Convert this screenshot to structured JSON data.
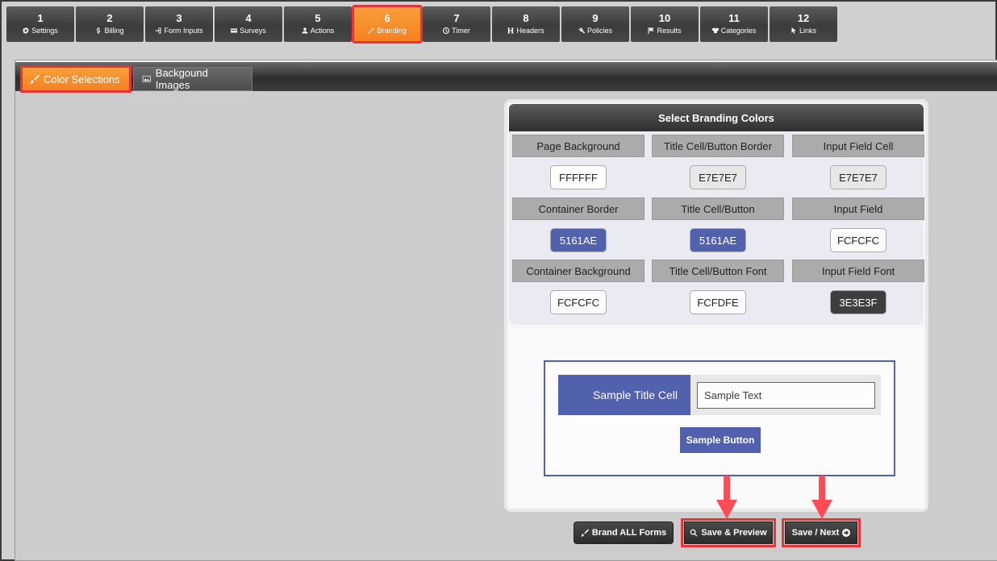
{
  "steps": [
    {
      "num": "1",
      "label": "Settings",
      "icon": "gear-icon"
    },
    {
      "num": "2",
      "label": "Billing",
      "icon": "dollar-icon"
    },
    {
      "num": "3",
      "label": "Form Inputs",
      "icon": "sign-in-icon"
    },
    {
      "num": "4",
      "label": "Surveys",
      "icon": "card-icon"
    },
    {
      "num": "5",
      "label": "Actions",
      "icon": "user-icon"
    },
    {
      "num": "6",
      "label": "Branding",
      "icon": "brush-icon"
    },
    {
      "num": "7",
      "label": "Timer",
      "icon": "clock-icon"
    },
    {
      "num": "8",
      "label": "Headers",
      "icon": "header-icon"
    },
    {
      "num": "9",
      "label": "Policies",
      "icon": "gavel-icon"
    },
    {
      "num": "10",
      "label": "Results",
      "icon": "flag-icon"
    },
    {
      "num": "11",
      "label": "Categories",
      "icon": "cubes-icon"
    },
    {
      "num": "12",
      "label": "Links",
      "icon": "pointer-icon"
    }
  ],
  "active_step": "6",
  "subtabs": {
    "colors": "Color Selections",
    "backgrounds": "Backgound Images"
  },
  "panel": {
    "title": "Select Branding Colors",
    "cells": [
      {
        "label": "Page Background",
        "value": "FFFFFF",
        "bg": "#FFFFFF",
        "fg": "#222222"
      },
      {
        "label": "Title Cell/Button Border",
        "value": "E7E7E7",
        "bg": "#E7E7E7",
        "fg": "#222222"
      },
      {
        "label": "Input Field Cell",
        "value": "E7E7E7",
        "bg": "#E7E7E7",
        "fg": "#222222"
      },
      {
        "label": "Container Border",
        "value": "5161AE",
        "bg": "#5161AE",
        "fg": "#FFFFFF"
      },
      {
        "label": "Title Cell/Button",
        "value": "5161AE",
        "bg": "#5161AE",
        "fg": "#FFFFFF"
      },
      {
        "label": "Input Field",
        "value": "FCFCFC",
        "bg": "#FCFCFC",
        "fg": "#222222"
      },
      {
        "label": "Container Background",
        "value": "FCFCFC",
        "bg": "#FCFCFC",
        "fg": "#222222"
      },
      {
        "label": "Title Cell/Button Font",
        "value": "FCFDFE",
        "bg": "#FCFDFE",
        "fg": "#222222"
      },
      {
        "label": "Input Field Font",
        "value": "3E3E3F",
        "bg": "#3E3E3F",
        "fg": "#FFFFFF"
      }
    ]
  },
  "sample": {
    "title_cell": "Sample Title Cell",
    "input_value": "Sample Text",
    "button": "Sample Button"
  },
  "buttons": {
    "brand_all": "Brand ALL Forms",
    "save_preview": "Save & Preview",
    "save_next": "Save / Next"
  },
  "colors": {
    "accent_orange": "#F4801F",
    "highlight_red": "#E8333B",
    "arrow_red": "#FF4B55"
  }
}
